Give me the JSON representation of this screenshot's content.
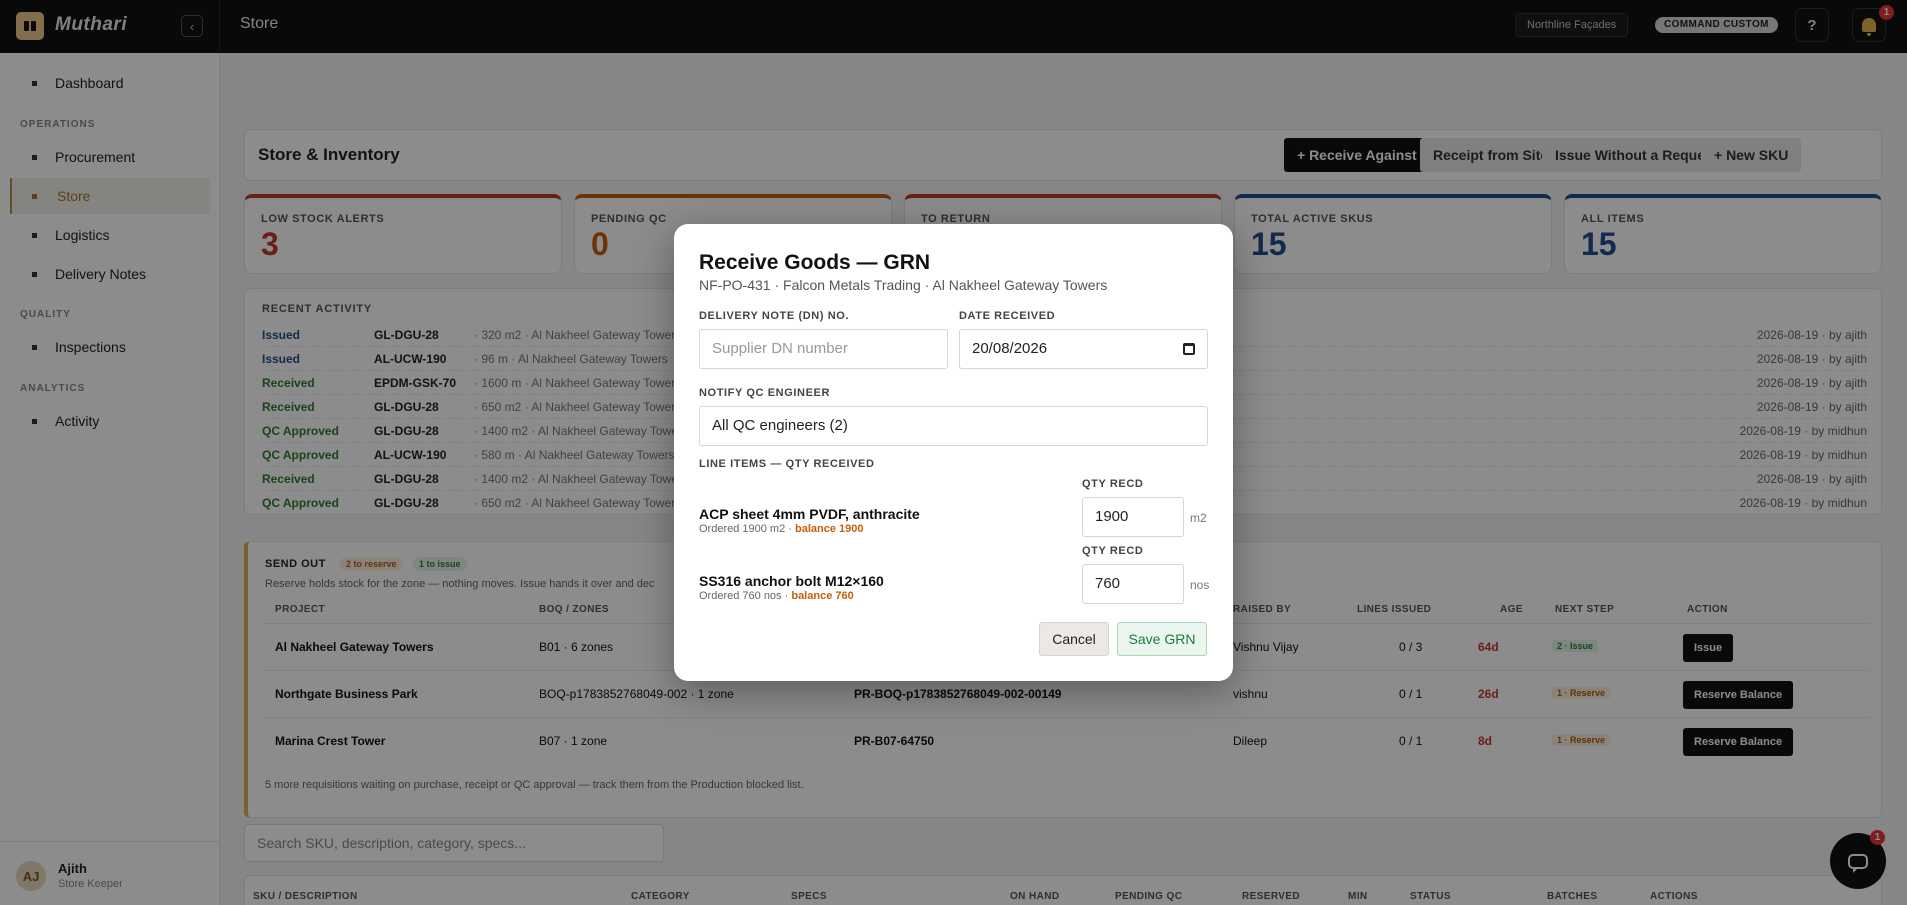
{
  "app": {
    "brand": "Muthari",
    "page_title": "Store",
    "company": "Northline Façades",
    "command_label": "COMMAND CUSTOM",
    "help": "?",
    "notifications": "1",
    "chat_badge": "1"
  },
  "sidebar": {
    "items": {
      "dashboard": "Dashboard",
      "procurement": "Procurement",
      "store": "Store",
      "logistics": "Logistics",
      "delivery_notes": "Delivery Notes",
      "inspections": "Inspections",
      "activity": "Activity"
    },
    "sections": {
      "operations": "OPERATIONS",
      "quality": "QUALITY",
      "analytics": "ANALYTICS"
    },
    "user": {
      "initials": "AJ",
      "name": "Ajith",
      "role": "Store Keeper"
    }
  },
  "header": {
    "title": "Store & Inventory",
    "btn_receive_po": "+ Receive Against PO",
    "btn_receipt_site": "Receipt from Site",
    "btn_issue_without": "Issue Without a Request",
    "btn_new_sku": "+ New SKU"
  },
  "stats": [
    {
      "label": "LOW STOCK ALERTS",
      "value": "3",
      "color": "#c0392b"
    },
    {
      "label": "PENDING QC",
      "value": "0",
      "color": "#c4600d"
    },
    {
      "label": "TO RETURN",
      "value": "",
      "color": "#c0392b"
    },
    {
      "label": "TOTAL ACTIVE SKUS",
      "value": "15",
      "color": "#1f4e8c"
    },
    {
      "label": "ALL ITEMS",
      "value": "15",
      "color": "#1f4e8c"
    }
  ],
  "activity": {
    "title": "RECENT ACTIVITY",
    "rows": [
      {
        "status": "Issued",
        "sku": "GL-DGU-28",
        "detail": "· 320 m2 · Al Nakheel Gateway Towers",
        "right": "2026-08-19 · by ajith"
      },
      {
        "status": "Issued",
        "sku": "AL-UCW-190",
        "detail": "· 96 m · Al Nakheel Gateway Towers",
        "right": "2026-08-19 · by ajith"
      },
      {
        "status": "Received",
        "sku": "EPDM-GSK-70",
        "detail": "· 1600 m · Al Nakheel Gateway Towers",
        "right": "2026-08-19 · by ajith"
      },
      {
        "status": "Received",
        "sku": "GL-DGU-28",
        "detail": "· 650 m2 · Al Nakheel Gateway Towers",
        "right": "2026-08-19 · by ajith"
      },
      {
        "status": "QC Approved",
        "sku": "GL-DGU-28",
        "detail": "· 1400 m2 · Al Nakheel Gateway Towers",
        "right": "2026-08-19 · by midhun"
      },
      {
        "status": "QC Approved",
        "sku": "AL-UCW-190",
        "detail": "· 580 m · Al Nakheel Gateway Towers",
        "right": "2026-08-19 · by midhun"
      },
      {
        "status": "Received",
        "sku": "GL-DGU-28",
        "detail": "· 1400 m2 · Al Nakheel Gateway Towers",
        "right": "2026-08-19 · by ajith"
      },
      {
        "status": "QC Approved",
        "sku": "GL-DGU-28",
        "detail": "· 650 m2 · Al Nakheel Gateway Towers",
        "right": "2026-08-19 · by midhun"
      }
    ]
  },
  "sendout": {
    "title": "SEND OUT",
    "pill_reserve": "2 to reserve",
    "pill_issue": "1 to issue",
    "subtitle": "Reserve holds stock for the zone — nothing moves. Issue hands it over and dec",
    "headers": {
      "project": "PROJECT",
      "boq": "BOQ / ZONES",
      "raised": "RAISED BY",
      "lines": "LINES ISSUED",
      "age": "AGE",
      "next": "NEXT STEP",
      "action": "ACTION"
    },
    "rows": [
      {
        "project": "Al Nakheel Gateway Towers",
        "boq": "B01 · 6 zones",
        "pr": "",
        "raised": "Vishnu Vijay",
        "lines": "0 / 3",
        "age": "64d",
        "next": "2 · Issue",
        "action": "Issue"
      },
      {
        "project": "Northgate Business Park",
        "boq": "BOQ-p1783852768049-002 · 1 zone",
        "pr": "PR-BOQ-p1783852768049-002-00149",
        "raised": "vishnu",
        "lines": "0 / 1",
        "age": "26d",
        "next": "1 · Reserve",
        "action": "Reserve Balance"
      },
      {
        "project": "Marina Crest Tower",
        "boq": "B07 · 1 zone",
        "pr": "PR-B07-64750",
        "raised": "Dileep",
        "lines": "0 / 1",
        "age": "8d",
        "next": "1 · Reserve",
        "action": "Reserve Balance"
      }
    ],
    "footer": "5 more requisitions waiting on purchase, receipt or QC approval — track them from the Production blocked list."
  },
  "search": {
    "placeholder": "Search SKU, description, category, specs..."
  },
  "inventory_table": {
    "headers": [
      "SKU / DESCRIPTION",
      "CATEGORY",
      "SPECS",
      "ON HAND",
      "PENDING QC",
      "RESERVED",
      "MIN",
      "STATUS",
      "BATCHES",
      "ACTIONS"
    ]
  },
  "modal": {
    "title": "Receive Goods — GRN",
    "subtitle": "NF-PO-431 · Falcon Metals Trading · Al Nakheel Gateway Towers",
    "dn_label": "DELIVERY NOTE (DN) NO.",
    "dn_placeholder": "Supplier DN number",
    "date_label": "DATE RECEIVED",
    "date_value": "20/08/2026",
    "notify_label": "NOTIFY QC ENGINEER",
    "notify_value": "All QC engineers (2)",
    "lines_label": "LINE ITEMS — QTY RECEIVED",
    "qty_label": "QTY RECD",
    "lines": [
      {
        "name": "ACP sheet 4mm PVDF, anthracite",
        "ordered": "Ordered 1900 m2 ·",
        "balance": "balance 1900",
        "qty": "1900",
        "unit": "m2"
      },
      {
        "name": "SS316 anchor bolt M12×160",
        "ordered": "Ordered 760 nos ·",
        "balance": "balance 760",
        "qty": "760",
        "unit": "nos"
      }
    ],
    "cancel": "Cancel",
    "save": "Save GRN"
  }
}
